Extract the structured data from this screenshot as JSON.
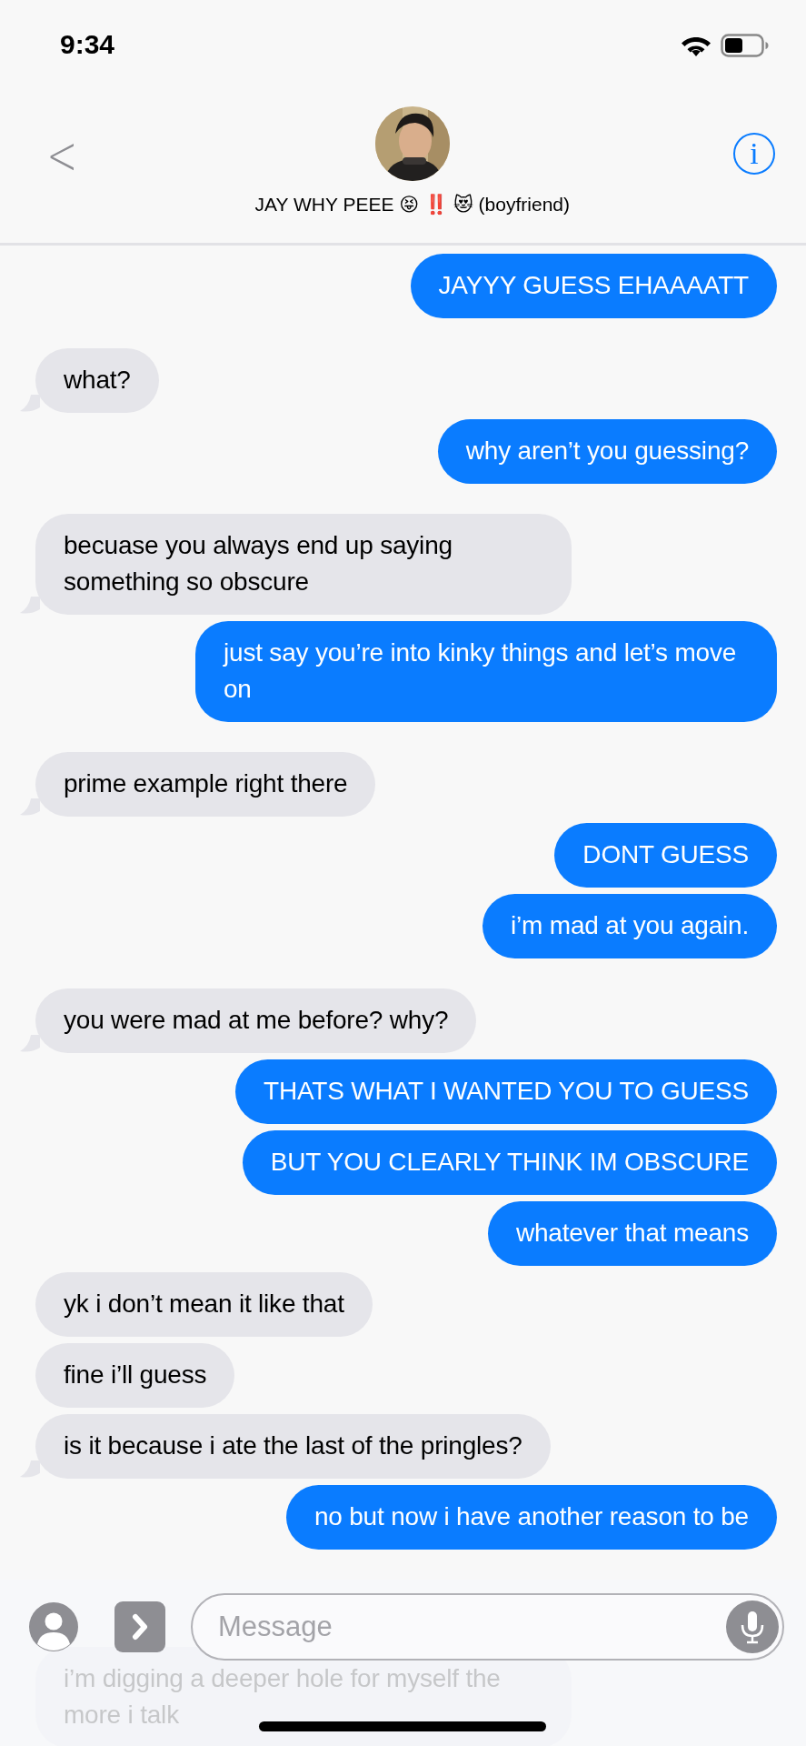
{
  "status_bar": {
    "time": "9:34"
  },
  "header": {
    "back": "<",
    "contact_name": "JAY WHY PEEE 😝 ‼️ 😻 (boyfriend)",
    "info": "i"
  },
  "messages": [
    {
      "kind": "sent",
      "text": "JAYYY GUESS EHAAAATT",
      "tail": false,
      "faded": false
    },
    {
      "kind": "received",
      "text": "what?",
      "tail": true,
      "faded": false
    },
    {
      "kind": "sent",
      "text": "why aren’t you guessing?",
      "tail": false,
      "faded": false
    },
    {
      "kind": "received",
      "text": "becuase you always end up saying something so obscure",
      "tail": true,
      "faded": false
    },
    {
      "kind": "sent",
      "text": "just say you’re into kinky things and let’s move on",
      "tail": false,
      "faded": false
    },
    {
      "kind": "received",
      "text": "prime example right there",
      "tail": true,
      "faded": false
    },
    {
      "kind": "sent",
      "text": "DONT GUESS",
      "tail": false,
      "faded": false
    },
    {
      "kind": "sent",
      "text": "i’m mad at you again.",
      "tail": false,
      "faded": false
    },
    {
      "kind": "received",
      "text": "you were mad at me before? why?",
      "tail": true,
      "faded": false
    },
    {
      "kind": "sent",
      "text": "THATS WHAT I WANTED YOU TO GUESS",
      "tail": false,
      "faded": false
    },
    {
      "kind": "sent",
      "text": "BUT YOU CLEARLY THINK IM OBSCURE",
      "tail": false,
      "faded": false
    },
    {
      "kind": "sent",
      "text": "whatever that means",
      "tail": false,
      "faded": false
    },
    {
      "kind": "received",
      "text": "yk i don’t mean it like that",
      "tail": false,
      "faded": false
    },
    {
      "kind": "received",
      "text": "fine i’ll guess",
      "tail": false,
      "faded": false
    },
    {
      "kind": "received",
      "text": "is it because i ate the last of the pringles?",
      "tail": true,
      "faded": false
    },
    {
      "kind": "sent",
      "text": "no but now i have another reason to be",
      "tail": false,
      "faded": false
    },
    {
      "kind": "received",
      "text": "i’m digging a deeper hole for myself the more i talk",
      "tail": false,
      "faded": true
    }
  ],
  "composer": {
    "placeholder": "Message"
  }
}
